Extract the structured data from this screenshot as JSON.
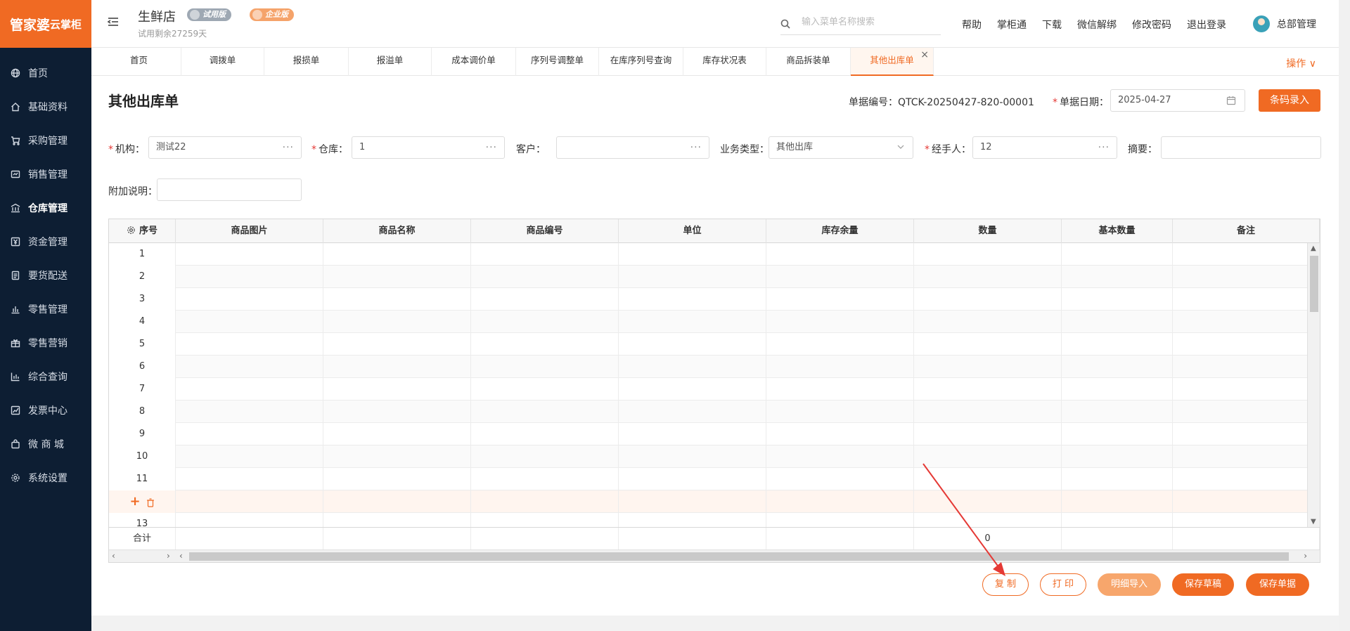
{
  "logo": {
    "brand": "管家婆",
    "product": "云掌柜"
  },
  "sidebar": {
    "items": [
      {
        "label": "首页",
        "icon": "globe-icon"
      },
      {
        "label": "基础资料",
        "icon": "home-icon"
      },
      {
        "label": "采购管理",
        "icon": "cart-icon"
      },
      {
        "label": "销售管理",
        "icon": "sales-icon"
      },
      {
        "label": "仓库管理",
        "icon": "warehouse-icon"
      },
      {
        "label": "资金管理",
        "icon": "money-icon"
      },
      {
        "label": "要货配送",
        "icon": "document-icon"
      },
      {
        "label": "零售管理",
        "icon": "bar-chart-icon"
      },
      {
        "label": "零售营销",
        "icon": "gift-icon"
      },
      {
        "label": "综合查询",
        "icon": "chart-icon"
      },
      {
        "label": "发票中心",
        "icon": "trend-icon"
      },
      {
        "label": "微 商 城",
        "icon": "bag-icon"
      },
      {
        "label": "系统设置",
        "icon": "gear-icon"
      }
    ],
    "active_index": 4
  },
  "header": {
    "store_name": "生鲜店",
    "badge_trial": "试用版",
    "badge_enterprise": "企业版",
    "trial_days": "试用剩余27259天",
    "search_placeholder": "输入菜单名称搜索",
    "links": [
      "帮助",
      "掌柜通",
      "下载",
      "微信解绑",
      "修改密码",
      "退出登录"
    ],
    "user_name": "总部管理"
  },
  "tabs": {
    "items": [
      "首页",
      "调拨单",
      "报损单",
      "报溢单",
      "成本调价单",
      "序列号调整单",
      "在库序列号查询",
      "库存状况表",
      "商品拆装单",
      "其他出库单"
    ],
    "active_index": 9,
    "close_glyph": "×",
    "ops_label": "操作 ∨"
  },
  "form": {
    "title": "其他出库单",
    "doc_no_label": "单据编号：",
    "doc_no_value": "QTCK-20250427-820-00001",
    "date_label": "单据日期：",
    "date_value": "2025-04-27",
    "barcode_btn": "条码录入",
    "org_label": "机构：",
    "org_value": "测试22",
    "warehouse_label": "仓库：",
    "warehouse_value": "1",
    "customer_label": "客户：",
    "customer_value": "",
    "biztype_label": "业务类型：",
    "biztype_value": "其他出库",
    "handler_label": "经手人：",
    "handler_value": "12",
    "summary_label": "摘要：",
    "summary_value": "",
    "extra_label": "附加说明：",
    "extra_value": "",
    "more_glyph": "···"
  },
  "grid": {
    "columns": [
      "序号",
      "商品图片",
      "商品名称",
      "商品编号",
      "单位",
      "库存余量",
      "数量",
      "基本数量",
      "备注"
    ],
    "rows": [
      "1",
      "2",
      "3",
      "4",
      "5",
      "6",
      "7",
      "8",
      "9",
      "10",
      "11",
      "",
      "13"
    ],
    "action_row_index": 11,
    "total_label": "合计",
    "total_qty": "0"
  },
  "buttons": {
    "copy": "复 制",
    "print": "打 印",
    "import": "明细导入",
    "save_draft": "保存草稿",
    "save": "保存单据"
  },
  "colors": {
    "accent": "#f06a23",
    "sidebar_bg": "#0d1e33",
    "annotation_arrow": "#e53935"
  }
}
